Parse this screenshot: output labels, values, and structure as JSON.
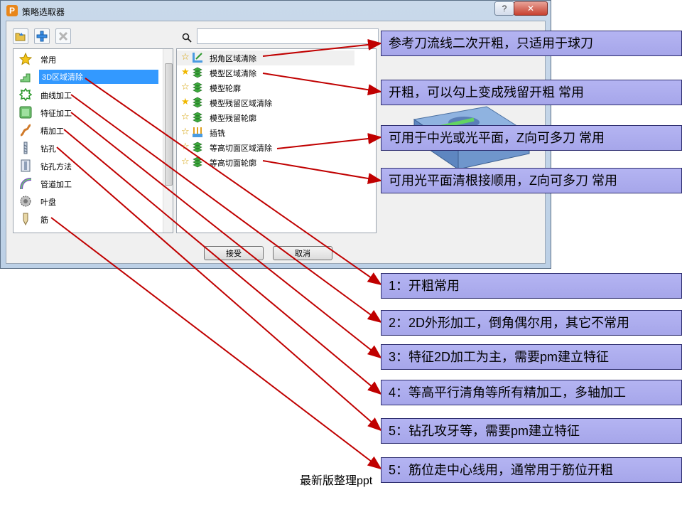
{
  "window": {
    "title": "策略选取器",
    "help_label": "?",
    "close_label": "✕",
    "app_icon": "P"
  },
  "toolbar": {
    "buttons": [
      {
        "name": "open-folder-icon"
      },
      {
        "name": "add-icon"
      },
      {
        "name": "delete-icon"
      }
    ]
  },
  "categories": [
    {
      "label": "常用",
      "icon": "star-icon"
    },
    {
      "label": "3D区域清除",
      "icon": "area-clear-icon",
      "selected": true
    },
    {
      "label": "曲线加工",
      "icon": "curve-icon"
    },
    {
      "label": "特征加工",
      "icon": "feature-icon"
    },
    {
      "label": "精加工",
      "icon": "finishing-icon"
    },
    {
      "label": "钻孔",
      "icon": "drill-icon"
    },
    {
      "label": "钻孔方法",
      "icon": "drill-method-icon"
    },
    {
      "label": "管道加工",
      "icon": "pipe-icon"
    },
    {
      "label": "叶盘",
      "icon": "blisk-icon"
    },
    {
      "label": "筋",
      "icon": "rib-icon"
    }
  ],
  "search": {
    "value": "",
    "placeholder": ""
  },
  "strategies": [
    {
      "label": "拐角区域清除",
      "starred": false
    },
    {
      "label": "模型区域清除",
      "starred": true
    },
    {
      "label": "模型轮廓",
      "starred": false
    },
    {
      "label": "模型残留区域清除",
      "starred": true
    },
    {
      "label": "模型残留轮廓",
      "starred": false
    },
    {
      "label": "插铣",
      "starred": false
    },
    {
      "label": "等高切面区域清除",
      "starred": false
    },
    {
      "label": "等高切面轮廓",
      "starred": false
    }
  ],
  "buttons": {
    "accept": "接受",
    "cancel": "取消"
  },
  "annotations": {
    "right": [
      "参考刀流线二次开粗，只适用于球刀",
      "开粗，可以勾上变成残留开粗            常用",
      "可用于中光或光平面，Z向可多刀        常用",
      "可用光平面清根接顺用，Z向可多刀    常用"
    ],
    "bottom": [
      "1：开粗常用",
      "2：2D外形加工，倒角偶尔用，其它不常用",
      "3：特征2D加工为主，需要pm建立特征",
      "4：等高平行清角等所有精加工，多轴加工",
      "5：钻孔攻牙等，需要pm建立特征",
      "5：筋位走中心线用，通常用于筋位开粗"
    ]
  },
  "footer": "最新版整理ppt",
  "colors": {
    "annotation_bg": "#aaaaee",
    "arrow": "#c00000",
    "selection": "#3399ff"
  }
}
